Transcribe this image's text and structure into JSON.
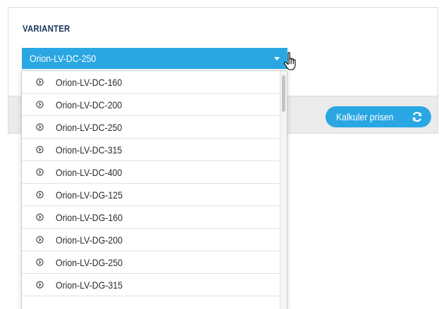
{
  "section": {
    "label": "VARIANTER"
  },
  "select": {
    "value": "Orion-LV-DC-250"
  },
  "dropdown": {
    "options": [
      {
        "label": "Orion-LV-DC-160"
      },
      {
        "label": "Orion-LV-DC-200"
      },
      {
        "label": "Orion-LV-DC-250"
      },
      {
        "label": "Orion-LV-DC-315"
      },
      {
        "label": "Orion-LV-DC-400"
      },
      {
        "label": "Orion-LV-DG-125"
      },
      {
        "label": "Orion-LV-DG-160"
      },
      {
        "label": "Orion-LV-DG-200"
      },
      {
        "label": "Orion-LV-DG-250"
      },
      {
        "label": "Orion-LV-DG-315"
      }
    ]
  },
  "calculate_button": {
    "label": "Kalkuler prisen",
    "icon": "refresh-icon"
  },
  "colors": {
    "accent": "#2aa7e3",
    "heading": "#1a3a5c",
    "footer": "#ebebeb"
  }
}
